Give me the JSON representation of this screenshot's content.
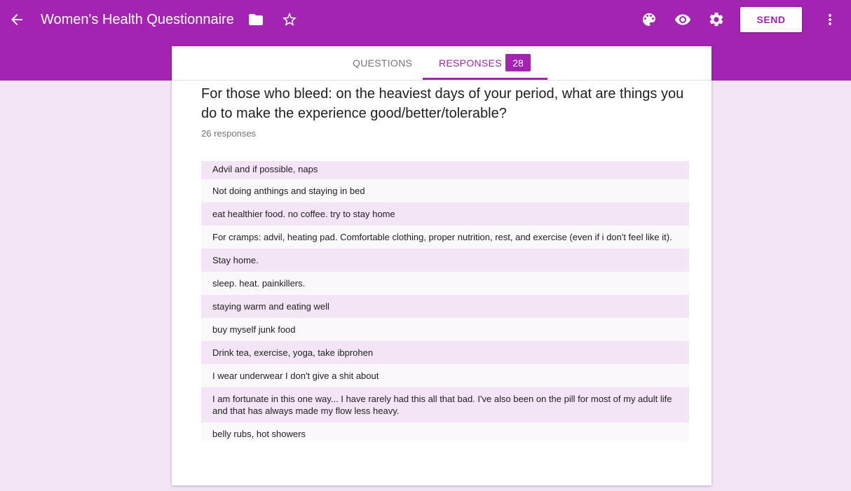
{
  "header": {
    "title": "Women's Health Questionnaire",
    "send_label": "SEND",
    "icons": [
      "arrow-back-icon",
      "folder-icon",
      "star-icon",
      "palette-icon",
      "eye-icon",
      "gear-icon",
      "more-vert-icon"
    ],
    "accent_color": "#a424b2"
  },
  "tabs": {
    "questions_label": "QUESTIONS",
    "responses_label": "RESPONSES",
    "responses_count": "28"
  },
  "question": {
    "text": "For those who bleed: on the heaviest days of your period, what are things you do to make the experience good/better/tolerable?",
    "response_count": "26 responses"
  },
  "responses": [
    "Advil and if possible, naps",
    "Not doing anthings and staying in bed",
    "eat healthier food. no coffee. try to stay home",
    "For cramps: advil, heating pad. Comfortable clothing, proper nutrition, rest, and exercise (even if i don't feel like it).",
    "Stay home.",
    "sleep. heat. painkillers.",
    "staying warm and eating well",
    "buy myself junk food",
    "Drink tea, exercise, yoga, take ibprohen",
    "I wear underwear I don't give a shit about",
    "I am fortunate in this one way... I have rarely had this all that bad. I've also been on the pill for most of my adult life and that has always made my flow less heavy.",
    "belly rubs, hot showers"
  ]
}
